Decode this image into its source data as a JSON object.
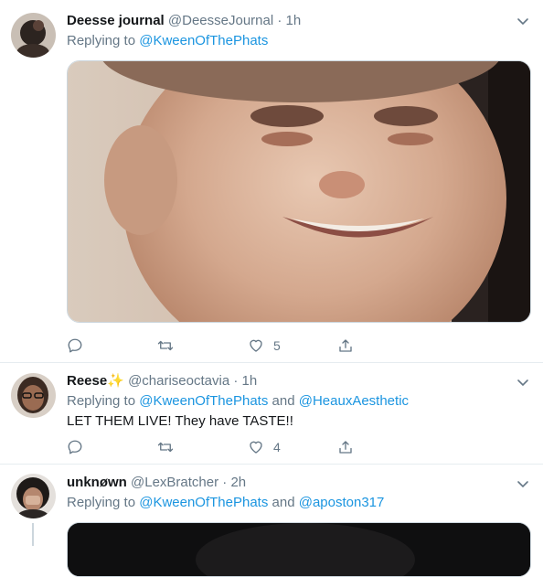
{
  "tweets": [
    {
      "name": "Deesse journal",
      "handle": "@DeesseJournal",
      "dot": "·",
      "time": "1h",
      "reply_prefix": "Replying to",
      "mentions": [
        "@KweenOfThePhats"
      ],
      "text": "",
      "actions": {
        "reply": "",
        "retweet": "",
        "like": "5",
        "share": ""
      }
    },
    {
      "name": "Reese",
      "emoji": "✨",
      "handle": "@chariseoctavia",
      "dot": "·",
      "time": "1h",
      "reply_prefix": "Replying to",
      "mentions": [
        "@KweenOfThePhats",
        "@HeauxAesthetic"
      ],
      "and": "and",
      "text": "LET THEM LIVE! They have TASTE!!",
      "actions": {
        "reply": "",
        "retweet": "",
        "like": "4",
        "share": ""
      }
    },
    {
      "name": "unknøwn",
      "handle": "@LexBratcher",
      "dot": "·",
      "time": "2h",
      "reply_prefix": "Replying to",
      "mentions": [
        "@KweenOfThePhats",
        "@aposton317"
      ],
      "and": "and",
      "text": ""
    }
  ],
  "colors": {
    "link": "#1b95e0",
    "muted": "#657786",
    "border": "#e6ecf0"
  },
  "icons": [
    "reply-icon",
    "retweet-icon",
    "like-icon",
    "share-icon",
    "chevron-down-icon"
  ]
}
